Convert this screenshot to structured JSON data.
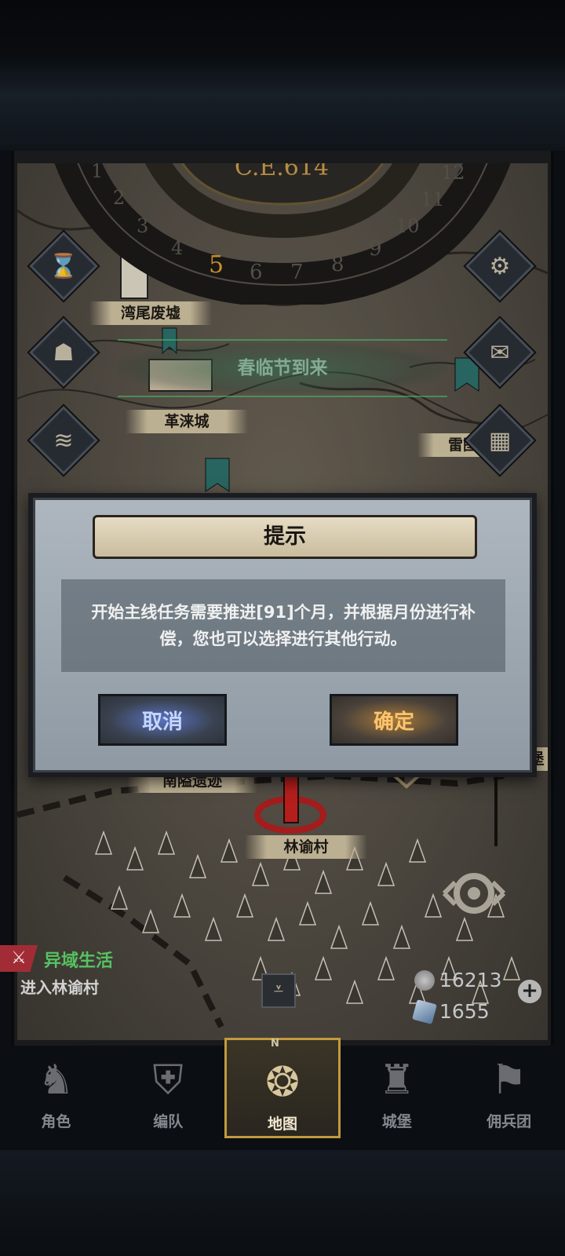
{
  "calendar": {
    "era": "C.E.614",
    "months": [
      "1",
      "2",
      "3",
      "4",
      "5",
      "6",
      "7",
      "8",
      "9",
      "10",
      "11",
      "12"
    ],
    "current_month": "5"
  },
  "map": {
    "locations": [
      {
        "name": "湾尾废墟"
      },
      {
        "name": "革涞城"
      },
      {
        "name": "雷图"
      },
      {
        "name": "南隘遗迹"
      },
      {
        "name": "林谕村"
      },
      {
        "name": "堡"
      }
    ]
  },
  "event_banner": "春临节到来",
  "dialog": {
    "title": "提示",
    "message": "开始主线任务需要推进[91]个月，并根据月份进行补偿，您也可以选择进行其他行动。",
    "cancel_label": "取消",
    "confirm_label": "确定"
  },
  "quest": {
    "title": "异域生活",
    "description": "进入林谕村"
  },
  "resources": {
    "silver": "16213",
    "crystal": "1655"
  },
  "nav": [
    {
      "label": "角色",
      "icon": "knight-helmet-icon"
    },
    {
      "label": "编队",
      "icon": "formation-icon"
    },
    {
      "label": "地图",
      "icon": "compass-map-icon"
    },
    {
      "label": "城堡",
      "icon": "castle-icon"
    },
    {
      "label": "佣兵团",
      "icon": "mercenary-icon"
    }
  ],
  "compass_letter": "N"
}
